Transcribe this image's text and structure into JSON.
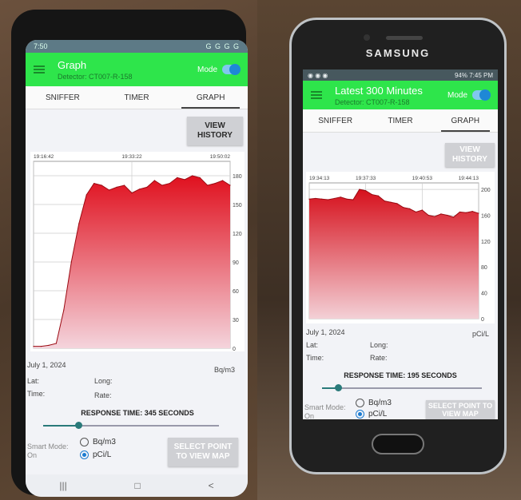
{
  "phone1": {
    "status": {
      "time": "7:50",
      "icons": "G G G G"
    },
    "appbar": {
      "title": "Graph",
      "subtitle": "Detector: CT007-R-158",
      "mode_label": "Mode"
    },
    "tabs": [
      "SNIFFER",
      "TIMER",
      "GRAPH"
    ],
    "view_history": "VIEW HISTORY",
    "chart_data": {
      "type": "area",
      "x_tick_labels": [
        "19:16:42",
        "19:33:22",
        "19:50:02"
      ],
      "y_ticks": [
        0,
        30,
        60,
        90,
        120,
        150,
        180
      ],
      "ylim": [
        0,
        195
      ],
      "unit": "Bq/m3",
      "values": [
        2,
        2,
        3,
        5,
        40,
        90,
        130,
        160,
        172,
        170,
        165,
        168,
        170,
        162,
        166,
        168,
        175,
        170,
        172,
        178,
        176,
        180,
        178,
        170,
        172,
        175,
        170
      ],
      "gridlines": true,
      "fill_colors": [
        "#e0101e",
        "#f4d4dc"
      ]
    },
    "date": "July 1, 2024",
    "lat_label": "Lat:",
    "long_label": "Long:",
    "time_label": "Time:",
    "rate_label": "Rate:",
    "unit_label": "Bq/m3",
    "response_time": "RESPONSE TIME: 345 SECONDS",
    "response_slider_fraction": 0.2,
    "smart_mode": {
      "label": "Smart Mode:",
      "value": "On"
    },
    "radio_options": [
      "Bq/m3",
      "pCi/L"
    ],
    "selected_unit": "pCi/L",
    "select_point": "SELECT POINT TO VIEW MAP",
    "nav": [
      "|||",
      "□",
      "<"
    ]
  },
  "phone2": {
    "brand": "SAMSUNG",
    "status": {
      "battery": "94%",
      "time": "7:45 PM"
    },
    "appbar": {
      "title": "Latest 300 Minutes",
      "subtitle": "Detector: CT007-R-158",
      "mode_label": "Mode"
    },
    "tabs": [
      "SNIFFER",
      "TIMER",
      "GRAPH"
    ],
    "view_history": "VIEW HISTORY",
    "chart_data": {
      "type": "area",
      "x_tick_labels": [
        "19:34:13",
        "19:37:33",
        "19:40:53",
        "19:44:13"
      ],
      "y_ticks": [
        0,
        40,
        80,
        120,
        160,
        200
      ],
      "ylim": [
        0,
        210
      ],
      "unit": "pCi/L",
      "values": [
        185,
        186,
        185,
        184,
        186,
        188,
        185,
        184,
        200,
        198,
        192,
        190,
        182,
        180,
        178,
        172,
        170,
        165,
        168,
        160,
        158,
        162,
        160,
        157,
        165,
        164,
        166,
        163
      ],
      "gridlines": true,
      "fill_colors": [
        "#d6101c",
        "#f3d0d6"
      ]
    },
    "date": "July 1, 2024",
    "lat_label": "Lat:",
    "long_label": "Long:",
    "time_label": "Time:",
    "rate_label": "Rate:",
    "unit_label": "pCi/L",
    "response_time": "RESPONSE TIME: 195 SECONDS",
    "response_slider_fraction": 0.1,
    "smart_mode": {
      "label": "Smart Mode:",
      "value": "On"
    },
    "radio_options": [
      "Bq/m3",
      "pCi/L"
    ],
    "selected_unit": "pCi/L",
    "select_point": "SELECT POINT TO VIEW MAP"
  }
}
